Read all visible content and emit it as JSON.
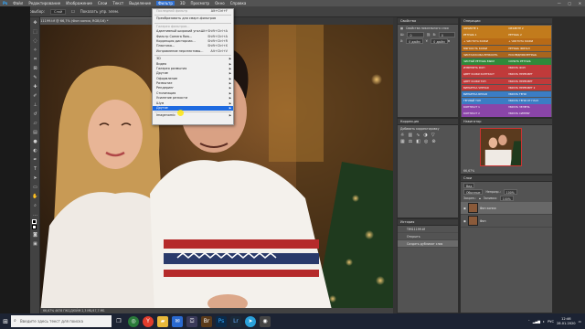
{
  "menubar": {
    "items": [
      "Файл",
      "Редактирование",
      "Изображение",
      "Слои",
      "Текст",
      "Выделение",
      "Фильтр",
      "3D",
      "Просмотр",
      "Окно",
      "Справка"
    ],
    "active_index": 6
  },
  "optionsbar": {
    "mode_label": "Автовыбор:",
    "mode_value": "Слой",
    "transform_label": "Показать упр. элем."
  },
  "document": {
    "tab_title": "TIM11199.tif @ 66,7% (Фон копия, RGB/16) *",
    "status": "66,67%    4678 ПКС/ДЮЙМ 2,3 МБ/47,7 МБ"
  },
  "filter_menu": {
    "items": [
      {
        "label": "Последний фильтр",
        "shortcut": "Alt+Ctrl+F",
        "dim": true
      },
      {
        "sep": true
      },
      {
        "label": "Преобразовать для смарт-фильтров"
      },
      {
        "sep": true
      },
      {
        "label": "Галерея фильтров...",
        "dim": true
      },
      {
        "label": "Адаптивный широкий угол...",
        "shortcut": "Alt+Shift+Ctrl+A"
      },
      {
        "label": "Фильтр Camera Raw...",
        "shortcut": "Shift+Ctrl+A"
      },
      {
        "label": "Коррекция дисторсии...",
        "shortcut": "Shift+Ctrl+R"
      },
      {
        "label": "Пластика...",
        "shortcut": "Shift+Ctrl+X"
      },
      {
        "label": "Исправление перспективы...",
        "shortcut": "Alt+Ctrl+V"
      },
      {
        "sep": true
      },
      {
        "label": "3D",
        "submenu": true
      },
      {
        "label": "Видео",
        "submenu": true
      },
      {
        "label": "Галерея размытия",
        "submenu": true
      },
      {
        "label": "Другие",
        "submenu": true
      },
      {
        "label": "Оформление",
        "submenu": true
      },
      {
        "label": "Размытие",
        "submenu": true
      },
      {
        "label": "Рендеринг",
        "submenu": true
      },
      {
        "label": "Стилизация",
        "submenu": true
      },
      {
        "label": "Усиление резкости",
        "submenu": true
      },
      {
        "label": "Шум",
        "submenu": true
      },
      {
        "label": "Другое",
        "submenu": true,
        "highlight": true
      },
      {
        "sep": true
      },
      {
        "label": "Imagenomic",
        "submenu": true
      }
    ]
  },
  "properties": {
    "title": "Свойства",
    "sub": "Свойства пиксельного слоя",
    "w_label": "Ш:",
    "w_value": "0 дюйм",
    "h_label": "В:",
    "h_value": "0 дюйм",
    "x_label": "X:",
    "x_value": "0 дюйм",
    "y_label": "Y:",
    "y_value": "0 дюйм"
  },
  "operations": {
    "title": "Операции",
    "items": [
      {
        "label": "ОБЪЕКТЕ 1",
        "color": "#c27b1c"
      },
      {
        "label": "ОБЪЕКТЕ 2",
        "color": "#c27b1c"
      },
      {
        "label": "РЕТУШЬ 1",
        "color": "#c27b1c"
      },
      {
        "label": "РЕТУШЬ 2",
        "color": "#c27b1c"
      },
      {
        "label": "+ ЧИСТОТА КОЖИ",
        "color": "#b86a16"
      },
      {
        "label": "+ ЧИСТОТА КОЖИ",
        "color": "#b86a16"
      },
      {
        "label": "МЯГКОСТЬ КОЖИ",
        "color": "#b86a16"
      },
      {
        "label": "РЕТУШЬ ФИНАЛ",
        "color": "#b86a16"
      },
      {
        "label": "ЧИСТАЯ КОЖА РЕЗКОСТЬ",
        "color": "#a8651e"
      },
      {
        "label": "ПОСЛЕДНЯЯ РЕТУШЬ",
        "color": "#a8651e"
      },
      {
        "label": "ЧИСТЫЙ РЕТУШЬ ВЫКЛ",
        "color": "#2f8a3a"
      },
      {
        "label": "СКРЫТЬ РЕТУШЬ",
        "color": "#2f8a3a"
      },
      {
        "label": "ИЗМЕНИТЬ ФОН",
        "color": "#c03a3a"
      },
      {
        "label": "УБРАТЬ ФОН",
        "color": "#c03a3a"
      },
      {
        "label": "ЦВЕТ КОЖИ КОНТРАСТ",
        "color": "#c03a3a"
      },
      {
        "label": "УБРАТЬ ПЕРЕСВЕТ",
        "color": "#c03a3a"
      },
      {
        "label": "ЦВЕТ КОЖИ ТОН",
        "color": "#c03a3a"
      },
      {
        "label": "УБРАТЬ ПЕРЕСВЕТ",
        "color": "#c03a3a"
      },
      {
        "label": "ВИНЬЕТКА ЧЕРНАЯ",
        "color": "#c03a3a"
      },
      {
        "label": "УБРАТЬ ПЕРЕСВЕТ 2",
        "color": "#c03a3a"
      },
      {
        "label": "ВИНЬЕТКА БЕЛАЯ",
        "color": "#3b7dc4"
      },
      {
        "label": "УБРАТЬ ТЕНИ",
        "color": "#3b7dc4"
      },
      {
        "label": "ТЕПЛЫЙ ТОН",
        "color": "#3b7dc4"
      },
      {
        "label": "УБРАТЬ ТЕНИ ОТ ГЛАЗ",
        "color": "#3b7dc4"
      },
      {
        "label": "КОНТРАСТ 1",
        "color": "#8a45a8"
      },
      {
        "label": "УБРАТЬ ЗЕЛЕНЬ",
        "color": "#8a45a8"
      },
      {
        "label": "КОНТРАСТ 2",
        "color": "#8a45a8"
      },
      {
        "label": "УБРАТЬ СИНЕВУ",
        "color": "#8a45a8"
      },
      {
        "label": "КОНТРАСТ 3",
        "color": "#6a6a6a"
      },
      {
        "label": "УБРАТЬ ЖЕЛТОЕ",
        "color": "#6a6a6a"
      }
    ]
  },
  "adjustments": {
    "title": "Коррекция",
    "sub": "Добавить корректировку"
  },
  "navigator": {
    "title": "Навигатор",
    "zoom": "66,67%"
  },
  "history": {
    "title": "История",
    "items": [
      {
        "label": "TIM11199.tif",
        "selected": false
      },
      {
        "label": "Открыть",
        "selected": false
      },
      {
        "label": "Создать дубликат слоя",
        "selected": true
      }
    ]
  },
  "layers": {
    "title": "Слои",
    "kind_label": "Вид",
    "blend": "Обычные",
    "opacity_label": "Непрозр.:",
    "opacity": "100%",
    "lock_label": "Закреп.:",
    "fill_label": "Заливка:",
    "fill": "100%",
    "items": [
      {
        "label": "Фон копия",
        "selected": true
      },
      {
        "label": "Фон",
        "selected": false
      }
    ]
  },
  "taskbar": {
    "search_placeholder": "Введите здесь текст для поиска",
    "lang": "РУС",
    "time": "12:46",
    "date": "28.01.2020"
  }
}
